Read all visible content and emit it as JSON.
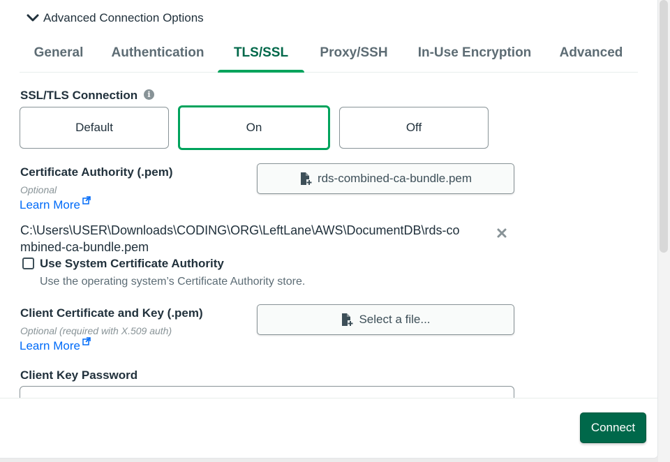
{
  "advanced_header": {
    "label": "Advanced Connection Options",
    "icon": "chevron-down-icon"
  },
  "tabs": [
    {
      "label": "General",
      "active": false
    },
    {
      "label": "Authentication",
      "active": false
    },
    {
      "label": "TLS/SSL",
      "active": true
    },
    {
      "label": "Proxy/SSH",
      "active": false
    },
    {
      "label": "In-Use Encryption",
      "active": false
    },
    {
      "label": "Advanced",
      "active": false
    }
  ],
  "ssl_tls": {
    "label": "SSL/TLS Connection",
    "info_icon": "info-icon",
    "options": [
      "Default",
      "On",
      "Off"
    ],
    "selected": "On"
  },
  "ca": {
    "label": "Certificate Authority (.pem)",
    "optional": "Optional",
    "learn_more": "Learn More",
    "file_button": "rds-combined-ca-bundle.pem",
    "file_path": "C:\\Users\\USER\\Downloads\\CODING\\ORG\\LeftLane\\AWS\\DocumentDB\\rds-combined-ca-bundle.pem"
  },
  "system_ca": {
    "label": "Use System Certificate Authority",
    "description": "Use the operating system’s Certificate Authority store.",
    "checked": false
  },
  "client_cert": {
    "label": "Client Certificate and Key (.pem)",
    "optional": "Optional (required with X.509 auth)",
    "learn_more": "Learn More",
    "file_button": "Select a file..."
  },
  "client_key_password": {
    "label": "Client Key Password",
    "value": ""
  },
  "footer": {
    "connect_label": "Connect"
  },
  "colors": {
    "accent_green": "#00a35c",
    "dark_green": "#00684a",
    "link_blue": "#016bf8"
  }
}
